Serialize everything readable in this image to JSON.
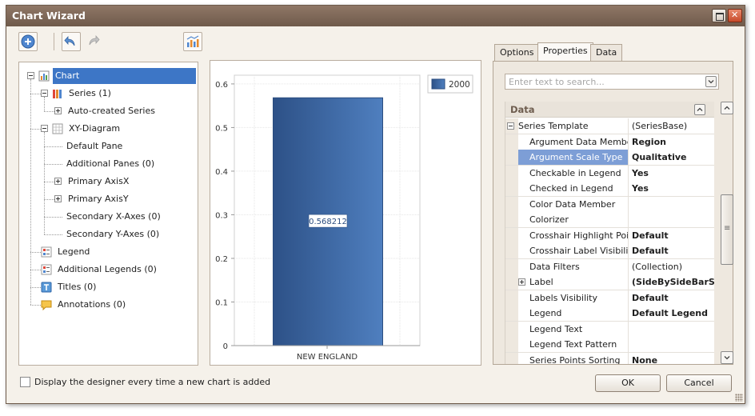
{
  "window": {
    "title": "Chart Wizard"
  },
  "tree": {
    "items": [
      {
        "label": "Chart",
        "icon": "chart-icon",
        "selected": true
      },
      {
        "label": "Series (1)",
        "icon": "series-icon"
      },
      {
        "label": "Auto-created Series"
      },
      {
        "label": "XY-Diagram",
        "icon": "diagram-icon"
      },
      {
        "label": "Default Pane"
      },
      {
        "label": "Additional Panes (0)"
      },
      {
        "label": "Primary AxisX"
      },
      {
        "label": "Primary AxisY"
      },
      {
        "label": "Secondary X-Axes (0)"
      },
      {
        "label": "Secondary Y-Axes (0)"
      },
      {
        "label": "Legend",
        "icon": "legend-icon"
      },
      {
        "label": "Additional Legends (0)",
        "icon": "legend-icon"
      },
      {
        "label": "Titles (0)",
        "icon": "title-icon"
      },
      {
        "label": "Annotations (0)",
        "icon": "annotation-icon"
      }
    ]
  },
  "chart_data": {
    "type": "bar",
    "categories": [
      "NEW ENGLAND"
    ],
    "series": [
      {
        "name": "2000",
        "values": [
          0.568212
        ],
        "color": "#3a6aa7"
      }
    ],
    "data_labels": [
      "0.568212"
    ],
    "yticks": [
      "0",
      "0.1",
      "0.2",
      "0.3",
      "0.4",
      "0.5",
      "0.6"
    ],
    "ylim": [
      0,
      0.62
    ],
    "legend_position": "top-right",
    "grid": true,
    "title": "",
    "xlabel": "",
    "ylabel": ""
  },
  "tabs": [
    {
      "label": "Options"
    },
    {
      "label": "Properties",
      "active": true
    },
    {
      "label": "Data"
    }
  ],
  "properties": {
    "search_placeholder": "Enter text to search...",
    "category": "Data",
    "rows": [
      {
        "name": "Series Template",
        "value": "(SeriesBase)",
        "level": 0,
        "expander": "minus",
        "bold": false
      },
      {
        "name": "Argument Data Member",
        "value": "Region",
        "level": 1,
        "bold": true
      },
      {
        "name": "Argument Scale Type",
        "value": "Qualitative",
        "level": 1,
        "bold": true,
        "selected": true
      },
      {
        "name": "Checkable in Legend",
        "value": "Yes",
        "level": 1,
        "bold": true
      },
      {
        "name": "Checked in Legend",
        "value": "Yes",
        "level": 1,
        "bold": true
      },
      {
        "name": "Color Data Member",
        "value": "",
        "level": 1
      },
      {
        "name": "Colorizer",
        "value": "",
        "level": 1
      },
      {
        "name": "Crosshair Highlight Points",
        "value": "Default",
        "level": 1,
        "bold": true
      },
      {
        "name": "Crosshair Label Visibility",
        "value": "Default",
        "level": 1,
        "bold": true
      },
      {
        "name": "Data Filters",
        "value": "(Collection)",
        "level": 1
      },
      {
        "name": "Label",
        "value": "(SideBySideBarS...",
        "level": 1,
        "expander": "plus",
        "bold": true
      },
      {
        "name": "Labels Visibility",
        "value": "Default",
        "level": 1,
        "bold": true
      },
      {
        "name": "Legend",
        "value": "Default Legend",
        "level": 1,
        "bold": true
      },
      {
        "name": "Legend Text",
        "value": "",
        "level": 1
      },
      {
        "name": "Legend Text Pattern",
        "value": "",
        "level": 1
      },
      {
        "name": "Series Points Sorting",
        "value": "None",
        "level": 1,
        "bold": true
      }
    ]
  },
  "footer": {
    "checkbox_label": "Display the designer every time a new chart is added",
    "checkbox_checked": false,
    "ok_label": "OK",
    "cancel_label": "Cancel"
  },
  "colors": {
    "accent": "#3d76c6",
    "title_bar": "#7d6657",
    "selection": "#7d9ed6",
    "bar": "#3a6aa7"
  }
}
